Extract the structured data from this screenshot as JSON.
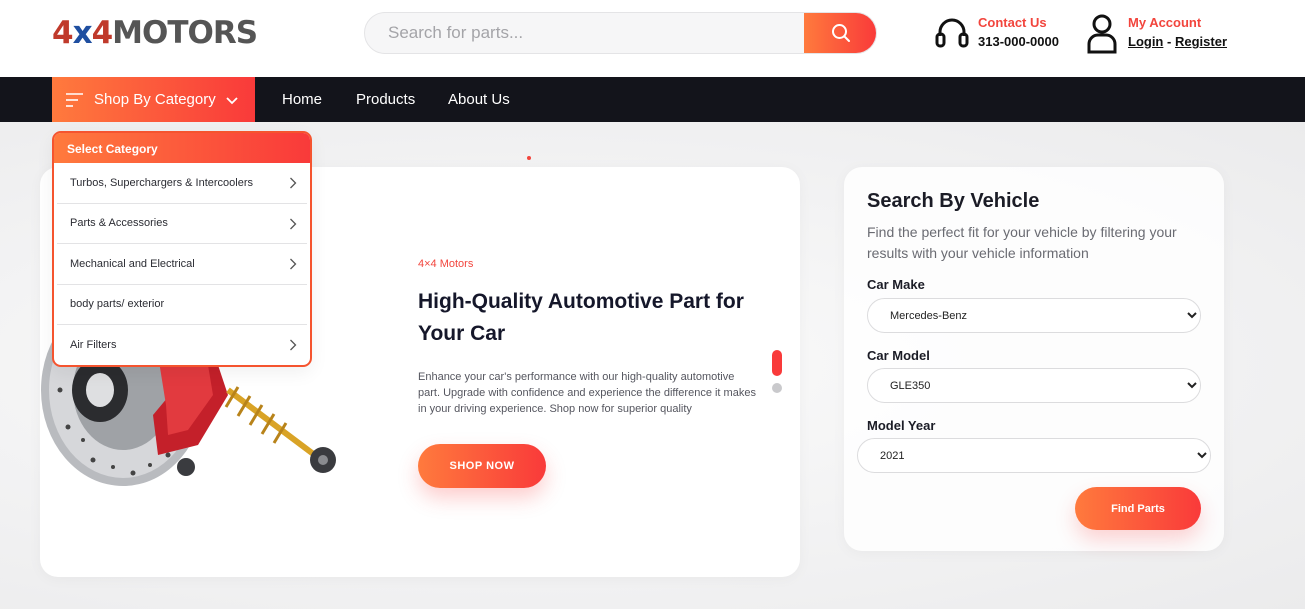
{
  "header": {
    "logo_text": "4x4MOTORS",
    "search": {
      "placeholder": "Search for parts..."
    },
    "contact": {
      "title": "Contact Us",
      "phone": "313-000-0000"
    },
    "account": {
      "title": "My Account",
      "login": "Login",
      "separator": "-",
      "register": "Register"
    }
  },
  "nav": {
    "category_button": "Shop By Category",
    "links": [
      "Home",
      "Products",
      "About Us"
    ]
  },
  "category_menu": {
    "title": "Select Category",
    "items": [
      {
        "label": "Turbos, Superchargers & Intercoolers",
        "has_submenu": true
      },
      {
        "label": "Parts & Accessories",
        "has_submenu": true
      },
      {
        "label": "Mechanical and Electrical",
        "has_submenu": true
      },
      {
        "label": "body parts/ exterior",
        "has_submenu": false
      },
      {
        "label": "Air Filters",
        "has_submenu": true
      }
    ]
  },
  "hero": {
    "brand": "4×4 Motors",
    "title": "High-Quality Automotive Part for Your Car",
    "description": "Enhance your car's performance with our high-quality automotive part. Upgrade with confidence and experience the difference it makes in your driving experience. Shop now for superior quality",
    "cta": "SHOP NOW",
    "slides_total": 2,
    "slide_active": 1
  },
  "vehicle_search": {
    "title": "Search By Vehicle",
    "description": "Find the perfect fit for your vehicle by filtering your results with your vehicle information",
    "make_label": "Car Make",
    "make_value": "Mercedes-Benz",
    "model_label": "Car Model",
    "model_value": "GLE350",
    "year_label": "Model Year",
    "year_value": "2021",
    "button": "Find Parts"
  },
  "colors": {
    "accent_start": "#ff7a3d",
    "accent_end": "#f93a3a",
    "nav_bg": "#13141b",
    "contact_red": "#f2453d"
  }
}
